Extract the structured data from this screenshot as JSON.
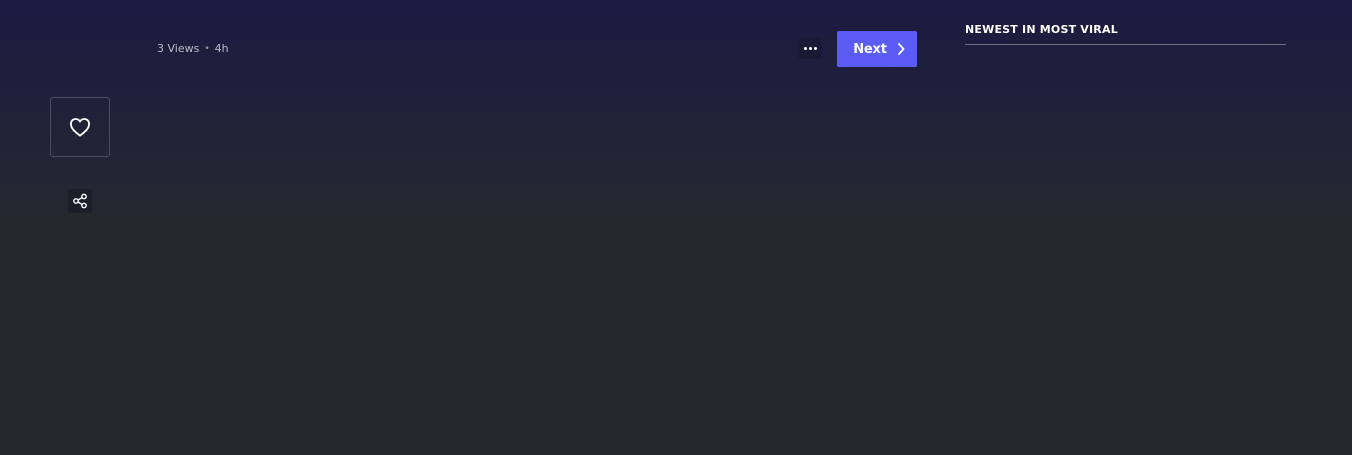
{
  "post_meta": {
    "views": "3 Views",
    "separator": "•",
    "age": "4h"
  },
  "actions": {
    "more_icon": "more-horizontal-icon",
    "next_label": "Next",
    "next_icon": "chevron-right-icon",
    "like_icon": "heart-icon",
    "share_icon": "share-icon"
  },
  "sidebar": {
    "heading": "NEWEST IN MOST VIRAL"
  },
  "colors": {
    "accent": "#5b5cf6",
    "background_top": "#1c1b42",
    "background_bottom": "#27282c"
  }
}
